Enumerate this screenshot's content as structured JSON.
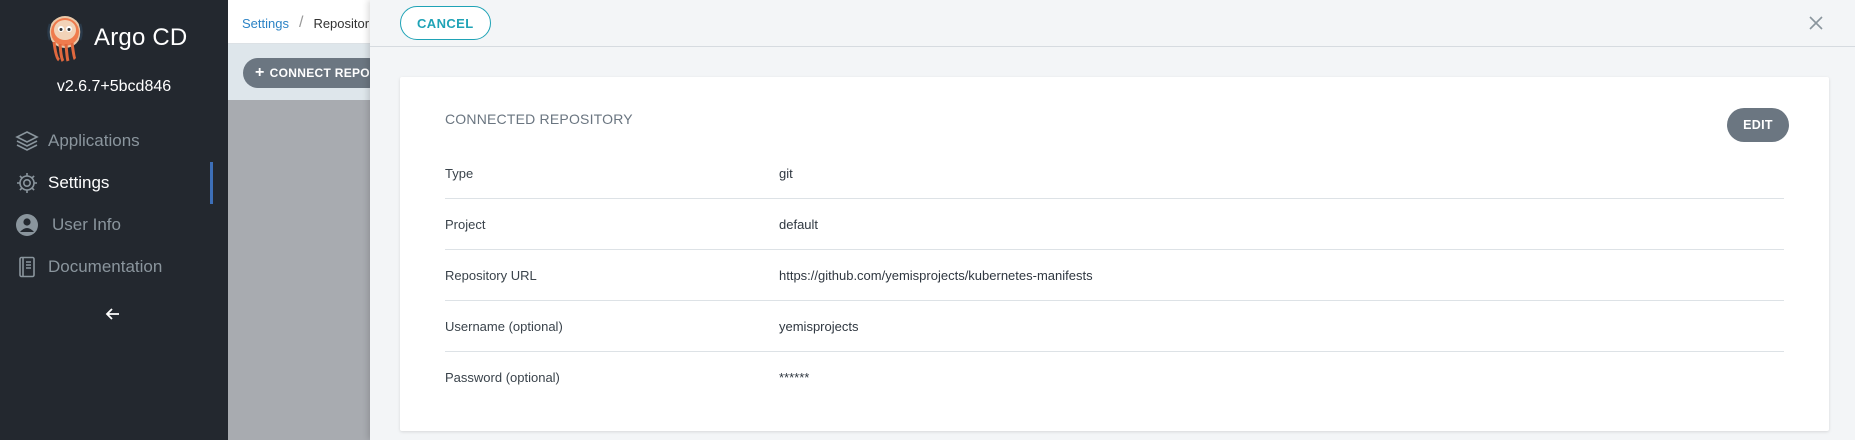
{
  "app": {
    "name": "Argo CD",
    "version": "v2.6.7+5bcd846"
  },
  "sidebar": {
    "items": [
      {
        "label": "Applications",
        "icon": "layers-icon",
        "active": false
      },
      {
        "label": "Settings",
        "icon": "gear-icon",
        "active": true
      },
      {
        "label": "User Info",
        "icon": "user-circle-icon",
        "active": false
      },
      {
        "label": "Documentation",
        "icon": "book-icon",
        "active": false
      }
    ],
    "collapse_icon": "arrow-left-icon"
  },
  "breadcrumb": {
    "parent": "Settings",
    "current": "Repositor"
  },
  "toolbar": {
    "connect_label": "CONNECT REPO"
  },
  "panel": {
    "cancel_label": "CANCEL",
    "close_icon": "close-icon",
    "card_title": "CONNECTED REPOSITORY",
    "edit_label": "EDIT",
    "fields": [
      {
        "label": "Type",
        "value": "git"
      },
      {
        "label": "Project",
        "value": "default"
      },
      {
        "label": "Repository URL",
        "value": "https://github.com/yemisprojects/kubernetes-manifests"
      },
      {
        "label": "Username (optional)",
        "value": "yemisprojects"
      },
      {
        "label": "Password (optional)",
        "value": "******"
      }
    ]
  },
  "colors": {
    "sidebar_bg": "#23282f",
    "accent": "#1fa3b6",
    "active_bar": "#3d6fb8",
    "button_gray": "#6b7681"
  }
}
